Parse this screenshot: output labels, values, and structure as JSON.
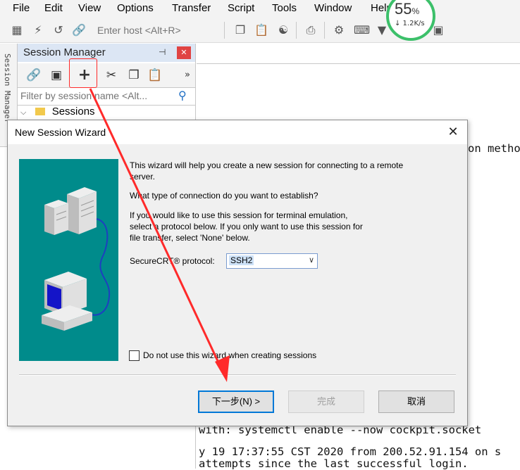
{
  "menubar": {
    "items": [
      "File",
      "Edit",
      "View",
      "Options",
      "Transfer",
      "Script",
      "Tools",
      "Window",
      "Help"
    ]
  },
  "toolbar": {
    "host_placeholder": "Enter host <Alt+R>",
    "icons": [
      "connect-tree-icon",
      "quick-connect-icon",
      "reconnect-icon",
      "disconnect-icon",
      "copy-icon",
      "paste-icon",
      "find-icon",
      "print-icon",
      "settings-icon",
      "keymap-icon",
      "sftp-icon",
      "sessions-icon"
    ]
  },
  "net_widget": {
    "percent": "55",
    "percent_unit": "%",
    "speed": "↓ 1.2K/s",
    "accent": "#3cc06a"
  },
  "side_tab": {
    "label": "Session Manager"
  },
  "session_manager": {
    "title": "Session Manager",
    "filter_placeholder": "Filter by session name <Alt...",
    "tree": [
      {
        "label": "Sessions",
        "expanded": true
      }
    ]
  },
  "terminal": {
    "lines": [
      "on metho",
      "with: systemctl enable --now cockpit.socket",
      "y 19 17:37:55 CST 2020 from 200.52.91.154 on s",
      "attempts since the last successful login."
    ]
  },
  "dialog": {
    "title": "New Session Wizard",
    "intro": "This wizard will help you create a new session for connecting to a remote server.",
    "question": "What type of connection do you want to establish?",
    "instructions_1": "If you would like to use this session for terminal emulation,",
    "instructions_2": "select a protocol below.  If you only want to use this session for",
    "instructions_3": "file transfer, select 'None' below.",
    "protocol_label": "SecureCRT® protocol:",
    "protocol_value": "SSH2",
    "checkbox_label": "Do not use this wizard when creating sessions",
    "checkbox_checked": false,
    "buttons": {
      "next": "下一步(N) >",
      "finish": "完成",
      "cancel": "取消"
    }
  },
  "colors": {
    "annotation": "#ff2a2a",
    "wizard_bg": "#008b8b"
  }
}
